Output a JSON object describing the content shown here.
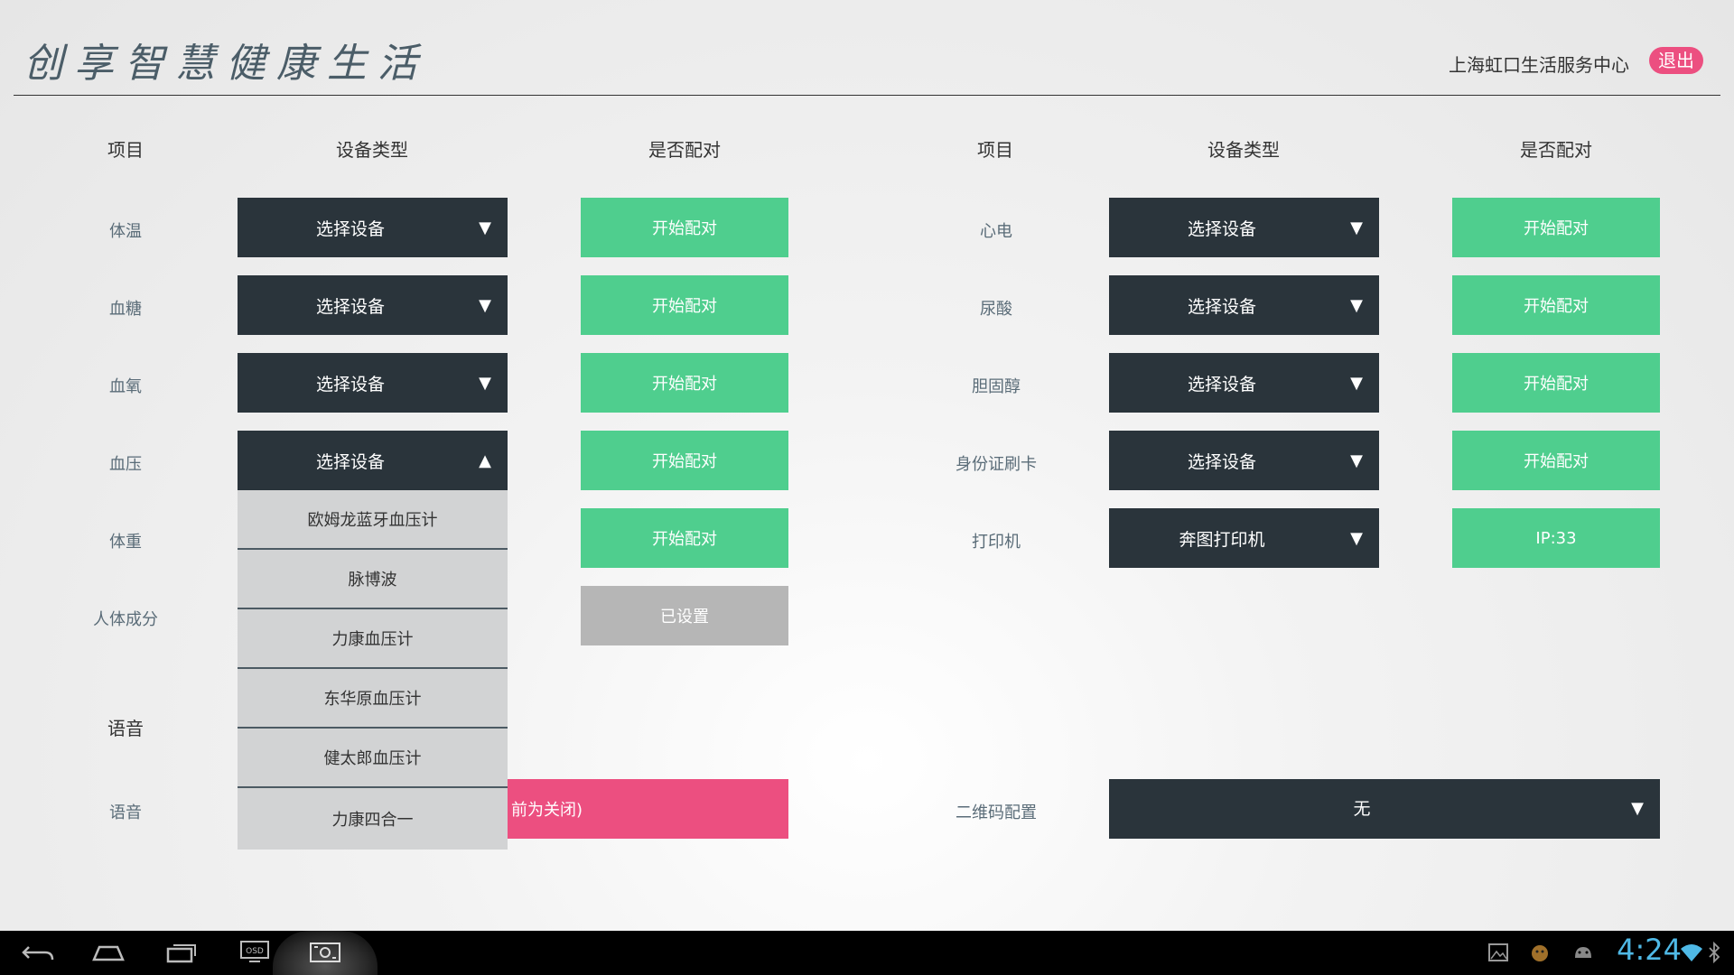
{
  "header": {
    "app_title": "创享智慧健康生活",
    "center_name": "上海虹口生活服务中心",
    "logout_label": "退出"
  },
  "columns": {
    "left": {
      "item": "项目",
      "device_type": "设备类型",
      "paired": "是否配对"
    },
    "right": {
      "item": "项目",
      "device_type": "设备类型",
      "paired": "是否配对"
    }
  },
  "left_rows": [
    {
      "label": "体温",
      "device": "选择设备",
      "arrow": "▼",
      "pair": "开始配对"
    },
    {
      "label": "血糖",
      "device": "选择设备",
      "arrow": "▼",
      "pair": "开始配对"
    },
    {
      "label": "血氧",
      "device": "选择设备",
      "arrow": "▼",
      "pair": "开始配对"
    },
    {
      "label": "血压",
      "device": "选择设备",
      "arrow": "▲",
      "pair": "开始配对"
    },
    {
      "label": "体重",
      "pair": "开始配对"
    },
    {
      "label": "人体成分",
      "pair": "已设置"
    }
  ],
  "right_rows": [
    {
      "label": "心电",
      "device": "选择设备",
      "arrow": "▼",
      "pair": "开始配对"
    },
    {
      "label": "尿酸",
      "device": "选择设备",
      "arrow": "▼",
      "pair": "开始配对"
    },
    {
      "label": "胆固醇",
      "device": "选择设备",
      "arrow": "▼",
      "pair": "开始配对"
    },
    {
      "label": "身份证刷卡",
      "device": "选择设备",
      "arrow": "▼",
      "pair": "开始配对"
    },
    {
      "label": "打印机",
      "device": "奔图打印机",
      "arrow": "▼",
      "pair": "IP:33"
    }
  ],
  "dropdown_options": [
    "欧姆龙蓝牙血压计",
    "脉博波",
    "力康血压计",
    "东华原血压计",
    "健太郎血压计",
    "力康四合一"
  ],
  "voice": {
    "section_title": "语音",
    "label": "语音",
    "button_text": "前为关闭)"
  },
  "qr": {
    "label": "二维码配置",
    "value": "无",
    "arrow": "▼"
  },
  "navbar": {
    "clock": "4:24",
    "back_icon": "back-icon",
    "home_icon": "home-icon",
    "recent_icon": "recent-apps-icon",
    "osd_label": "OSD",
    "screenshot_icon": "screenshot-icon"
  }
}
